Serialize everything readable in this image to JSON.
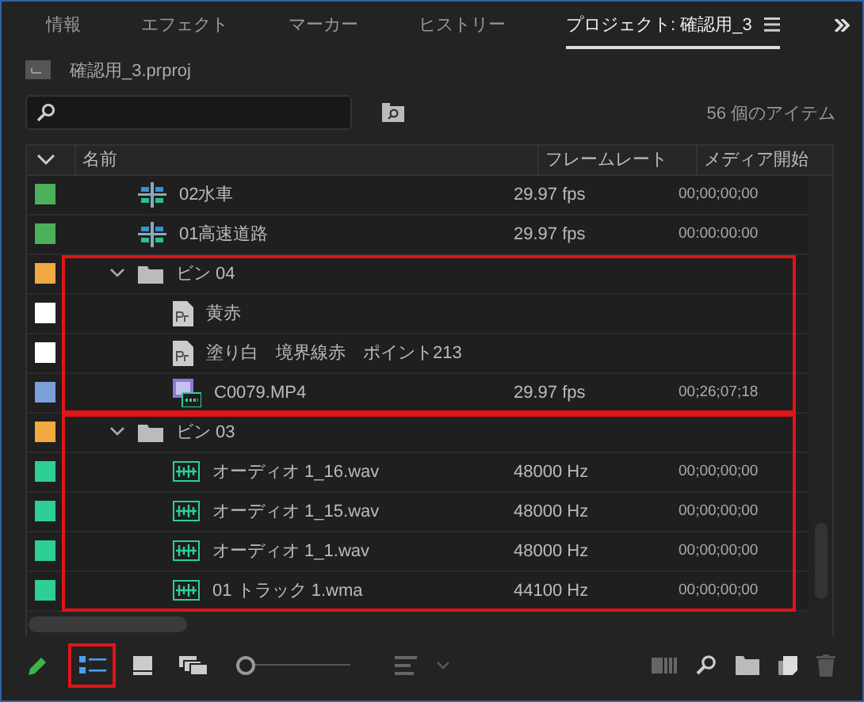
{
  "tabs": [
    {
      "label": "情報",
      "selected": false
    },
    {
      "label": "エフェクト",
      "selected": false
    },
    {
      "label": "マーカー",
      "selected": false
    },
    {
      "label": "ヒストリー",
      "selected": false
    },
    {
      "label": "プロジェクト: 確認用_3",
      "selected": true
    }
  ],
  "project_file": "確認用_3.prproj",
  "item_count": "56 個のアイテム",
  "table": {
    "columns": [
      "名前",
      "フレームレート",
      "メディア開始"
    ],
    "rows": [
      {
        "kind": "sequence",
        "color": "#4cb05a",
        "name": "02水車",
        "frame_rate": "29.97 fps",
        "media_start": "00;00;00;00"
      },
      {
        "kind": "sequence",
        "color": "#4cb05a",
        "name": "01高速道路",
        "frame_rate": "29.97 fps",
        "media_start": "00:00:00:00"
      },
      {
        "kind": "folder",
        "color": "#f0a840",
        "name": "ビン 04",
        "expanded": true,
        "highlighted": true,
        "children": [
          {
            "kind": "title",
            "color": "#ffffff",
            "name": "黄赤"
          },
          {
            "kind": "title",
            "color": "#ffffff",
            "name": "塗り白　境界線赤　ポイント213"
          },
          {
            "kind": "video",
            "color": "#7b9fd8",
            "name": "C0079.MP4",
            "frame_rate": "29.97 fps",
            "media_start": "00;26;07;18"
          }
        ]
      },
      {
        "kind": "folder",
        "color": "#f0a840",
        "name": "ビン 03",
        "expanded": true,
        "highlighted": true,
        "children": [
          {
            "kind": "audio",
            "color": "#2ecf94",
            "name": "オーディオ 1_16.wav",
            "frame_rate": "48000 Hz",
            "media_start": "00;00;00;00"
          },
          {
            "kind": "audio",
            "color": "#2ecf94",
            "name": "オーディオ 1_15.wav",
            "frame_rate": "48000 Hz",
            "media_start": "00;00;00;00"
          },
          {
            "kind": "audio",
            "color": "#2ecf94",
            "name": "オーディオ 1_1.wav",
            "frame_rate": "48000 Hz",
            "media_start": "00;00;00;00"
          },
          {
            "kind": "audio",
            "color": "#2ecf94",
            "name": "01 トラック 1.wma",
            "frame_rate": "44100 Hz",
            "media_start": "00;00;00;00"
          }
        ]
      }
    ]
  },
  "view_buttons": [
    {
      "kind": "list",
      "selected": true,
      "highlighted": true
    },
    {
      "kind": "icon",
      "selected": false,
      "highlighted": false
    },
    {
      "kind": "freeform",
      "selected": false,
      "highlighted": false
    }
  ],
  "zoom_slider": {
    "level": 0.0
  },
  "delete_button": {
    "disabled": true
  }
}
